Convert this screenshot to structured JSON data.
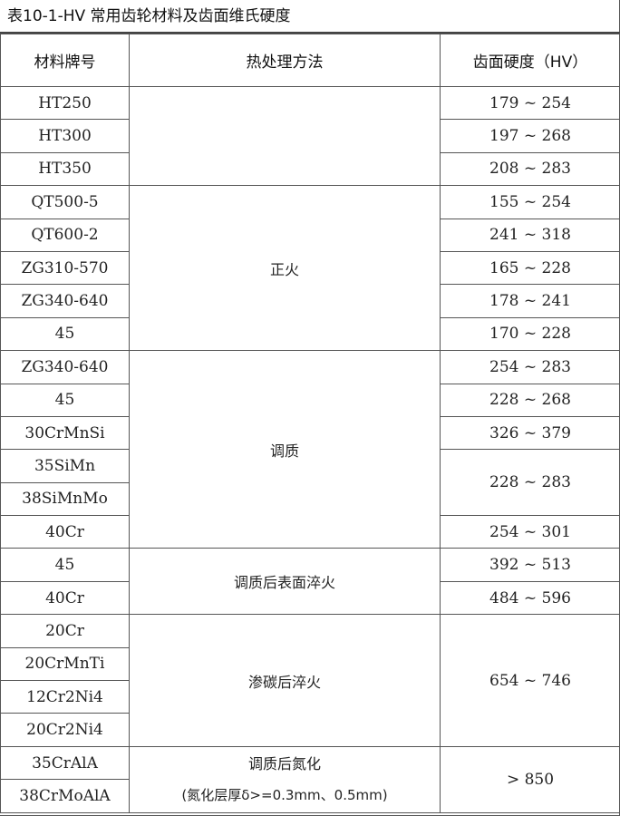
{
  "caption": "表10-1-HV 常用齿轮材料及齿面维氏硬度",
  "headers": {
    "material": "材料牌号",
    "treatment": "热处理方法",
    "hardness": "齿面硬度（HV）"
  },
  "materials": [
    "HT250",
    "HT300",
    "HT350",
    "QT500-5",
    "QT600-2",
    "ZG310-570",
    "ZG340-640",
    "45",
    "ZG340-640",
    "45",
    "30CrMnSi",
    "35SiMn",
    "38SiMnMo",
    "40Cr",
    "45",
    "40Cr",
    "20Cr",
    "20CrMnTi",
    "12Cr2Ni4",
    "20Cr2Ni4",
    "35CrAlA",
    "38CrMoAlA"
  ],
  "treatments": {
    "normalizing": "正火",
    "quench_temper": "调质",
    "surface_quench": "调质后表面淬火",
    "carburizing": "渗碳后淬火",
    "nitriding": "调质后氮化",
    "nitriding_note": "(氮化层厚δ>=0.3mm、0.5mm)"
  },
  "hardness": [
    "179 ~ 254",
    "197 ~ 268",
    "208 ~ 283",
    "155 ~ 254",
    "241 ~ 318",
    "165 ~ 228",
    "178 ~ 241",
    "170 ~ 228",
    "254 ~ 283",
    "228 ~ 268",
    "326 ~ 379",
    "228 ~ 283",
    "254 ~ 301",
    "392 ~ 513",
    "484 ~ 596",
    "654 ~ 746",
    "> 850"
  ]
}
